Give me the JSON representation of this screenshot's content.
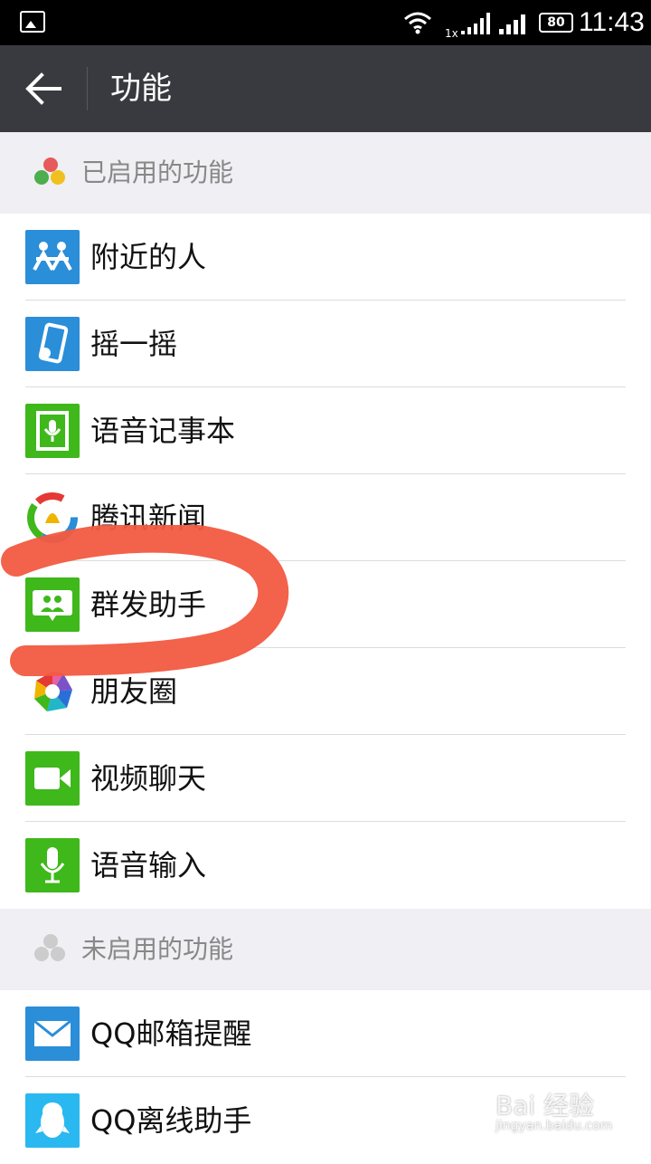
{
  "statusbar": {
    "network": "1x",
    "battery": "80",
    "time": "11:43"
  },
  "titlebar": {
    "back_icon": "arrow-left-icon",
    "title": "功能"
  },
  "enabled_section": {
    "header": "已启用的功能",
    "items": [
      {
        "label": "附近的人",
        "icon": "people-nearby-icon",
        "color": "#2a8ed8"
      },
      {
        "label": "摇一摇",
        "icon": "shake-phone-icon",
        "color": "#2a8ed8"
      },
      {
        "label": "语音记事本",
        "icon": "voice-notebook-icon",
        "color": "#3eb81a"
      },
      {
        "label": "腾讯新闻",
        "icon": "tencent-news-icon",
        "color": "#ffffff"
      },
      {
        "label": "群发助手",
        "icon": "broadcast-assistant-icon",
        "color": "#3eb81a"
      },
      {
        "label": "朋友圈",
        "icon": "moments-aperture-icon",
        "color": "#ffffff"
      },
      {
        "label": "视频聊天",
        "icon": "video-camera-icon",
        "color": "#3eb81a"
      },
      {
        "label": "语音输入",
        "icon": "microphone-icon",
        "color": "#3eb81a"
      }
    ]
  },
  "disabled_section": {
    "header": "未启用的功能",
    "items": [
      {
        "label": "QQ邮箱提醒",
        "icon": "mail-envelope-icon",
        "color": "#2a8ed8"
      },
      {
        "label": "QQ离线助手",
        "icon": "qq-penguin-icon",
        "color": "#2ab8f0"
      }
    ]
  },
  "watermark": {
    "brand": "Bai 经验",
    "url": "jingyan.baidu.com"
  }
}
